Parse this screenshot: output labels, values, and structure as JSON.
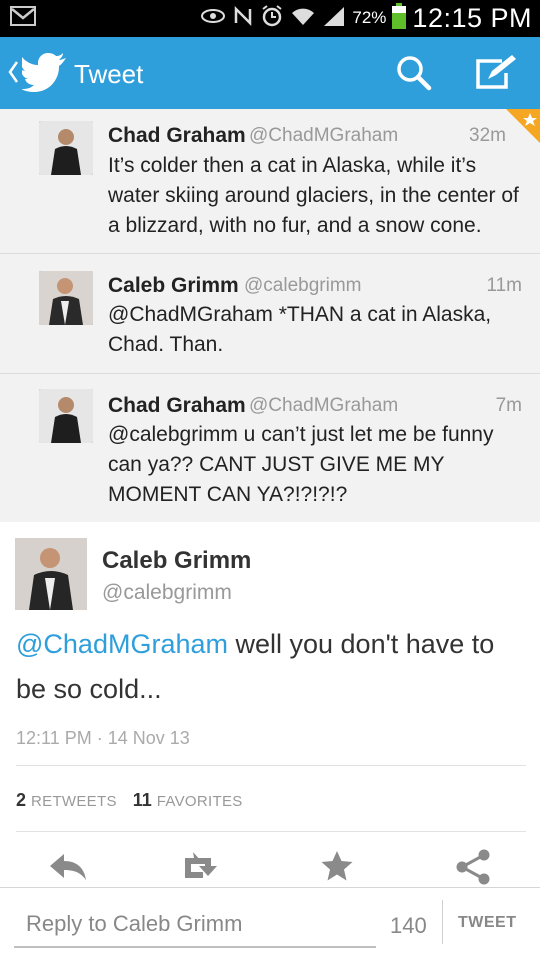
{
  "status_bar": {
    "icons": [
      "gmail-icon",
      "eye-icon",
      "nfc-icon",
      "alarm-icon",
      "wifi-icon",
      "signal-icon",
      "battery-icon"
    ],
    "battery": "72%",
    "time": "12:15 PM"
  },
  "action_bar": {
    "title": "Tweet",
    "color": "#2f9fdc"
  },
  "conversation": [
    {
      "name": "Chad Graham",
      "handle": "@ChadMGraham",
      "time": "32m",
      "text": "It’s colder then a cat in Alaska, while it’s water skiing around glaciers, in the center of a blizzard, with no fur, and a snow cone.",
      "favorited": true
    },
    {
      "name": "Caleb Grimm",
      "handle": "@calebgrimm",
      "time": "11m",
      "text": "@ChadMGraham *THAN a cat in Alaska, Chad. Than."
    },
    {
      "name": "Chad Graham",
      "handle": "@ChadMGraham",
      "time": "7m",
      "text": "@calebgrimm u can’t just let me be funny can ya?? CANT JUST GIVE ME MY MOMENT CAN YA?!?!?!?"
    }
  ],
  "main_tweet": {
    "name": "Caleb Grimm",
    "handle": "@calebgrimm",
    "mention": "@ChadMGraham",
    "text": " well you don't have to be so cold...",
    "timestamp": "12:11 PM · 14 Nov 13",
    "retweets_count": "2",
    "retweets_label": "RETWEETS",
    "favorites_count": "11",
    "favorites_label": "FAVORITES"
  },
  "reply": {
    "placeholder": "Reply to Caleb Grimm",
    "char_count": "140",
    "button_label": "TWEET"
  }
}
